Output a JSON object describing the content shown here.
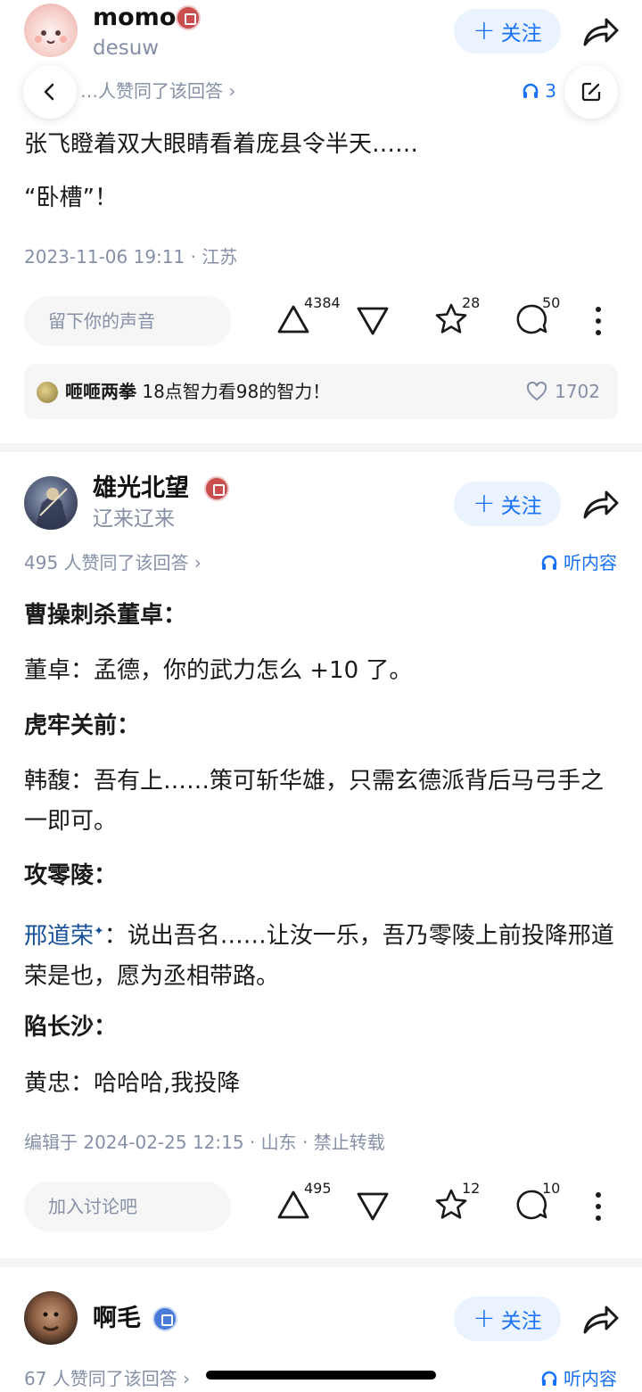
{
  "answers": [
    {
      "author": "momo",
      "bio": "desuw",
      "follow_label": "关注",
      "agree_text": "…人赞同了该回答 ›",
      "listen_text": "3",
      "paragraphs": [
        "张飞瞪着双大眼睛看着庞县令半天……",
        "“卧槽”！"
      ],
      "meta": "2023-11-06 19:11 · 江苏",
      "comment_placeholder": "留下你的声音",
      "upvotes": "4384",
      "stars": "28",
      "comments": "50",
      "hot_comment": {
        "user": "咂咂两拳",
        "text": "18点智力看98的智力！",
        "likes": "1702"
      }
    },
    {
      "author": "雄光北望",
      "bio": "辽来辽来",
      "follow_label": "关注",
      "agree_text": "495 人赞同了该回答 ›",
      "listen_text": "听内容",
      "paragraphs": [
        "曹操刺杀董卓：",
        "董卓：孟德，你的武力怎么 +10 了。",
        "虎牢关前：",
        "韩馥：吾有上……策可斩华雄，只需玄德派背后马弓手之一即可。",
        "攻零陵：",
        "说出吾名……让汝一乐，吾乃零陵上前投降邢道荣是也，愿为丞相带路。",
        "陷长沙：",
        "黄忠：哈哈哈,我投降"
      ],
      "link_name": "邢道荣",
      "link_sup": "✦",
      "link_suffix": "：",
      "meta": "编辑于 2024-02-25 12:15 · 山东 · 禁止转载",
      "comment_placeholder": "加入讨论吧",
      "upvotes": "495",
      "stars": "12",
      "comments": "10"
    },
    {
      "author": "啊毛",
      "follow_label": "关注",
      "agree_text": "67 人赞同了该回答 ›",
      "listen_text": "听内容"
    }
  ],
  "colors": {
    "accent": "#1772f6",
    "muted": "#8590a6",
    "link": "#175199"
  },
  "icons": [
    "back-arrow-icon",
    "edit-icon",
    "share-icon",
    "headphone-icon",
    "upvote-icon",
    "downvote-icon",
    "star-icon",
    "comment-icon",
    "more-icon",
    "heart-icon",
    "badge-icon"
  ]
}
